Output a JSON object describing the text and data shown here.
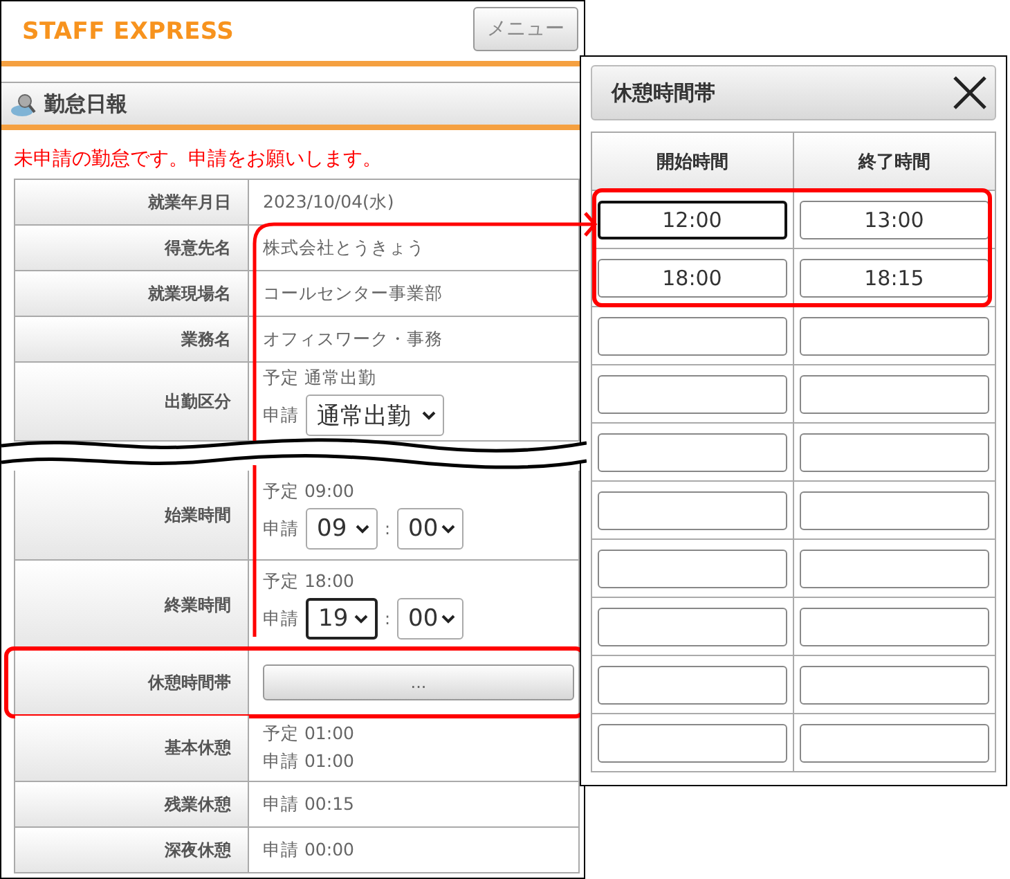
{
  "header": {
    "logo": "STAFF EXPRESS",
    "menu_button": "メニュー"
  },
  "section": {
    "title": "勤怠日報"
  },
  "notice": "未申請の勤怠です。申請をお願いします。",
  "form_rows": [
    {
      "kind": "text",
      "label": "就業年月日",
      "value": "2023/10/04(水)"
    },
    {
      "kind": "text",
      "label": "得意先名",
      "value": "株式会社とうきょう"
    },
    {
      "kind": "text",
      "label": "就業現場名",
      "value": "コールセンター事業部"
    },
    {
      "kind": "text",
      "label": "業務名",
      "value": "オフィスワーク・事務"
    },
    {
      "kind": "select",
      "label": "出勤区分",
      "planned": "予定 通常出勤",
      "request_label": "申請",
      "value": "通常出勤"
    },
    {
      "kind": "omission"
    },
    {
      "kind": "time",
      "label": "始業時間",
      "planned": "予定 09:00",
      "request_label": "申請",
      "hour": "09",
      "separator": ":",
      "minute": "00",
      "hour_focused": false
    },
    {
      "kind": "time",
      "label": "終業時間",
      "planned": "予定 18:00",
      "request_label": "申請",
      "hour": "19",
      "separator": ":",
      "minute": "00",
      "hour_focused": true
    },
    {
      "kind": "button",
      "label": "休憩時間帯",
      "button": "...",
      "highlighted": true
    },
    {
      "kind": "lines",
      "label": "基本休憩",
      "lines": [
        "予定 01:00",
        "申請 01:00"
      ]
    },
    {
      "kind": "text",
      "label": "残業休憩",
      "value": "申請 00:15"
    },
    {
      "kind": "text",
      "label": "深夜休憩",
      "value": "申請 00:00"
    }
  ],
  "dialog": {
    "title": "休憩時間帯",
    "columns": [
      "開始時間",
      "終了時間"
    ],
    "rows": [
      {
        "start": "12:00",
        "end": "13:00",
        "start_focused": true,
        "highlighted": true
      },
      {
        "start": "18:00",
        "end": "18:15",
        "start_focused": false,
        "highlighted": true
      },
      {
        "start_focused": false,
        "highlighted": false
      },
      {
        "start_focused": false,
        "highlighted": false
      },
      {
        "start_focused": false,
        "highlighted": false
      },
      {
        "start_focused": false,
        "highlighted": false
      },
      {
        "start_focused": false,
        "highlighted": false
      },
      {
        "start_focused": false,
        "highlighted": false
      },
      {
        "start_focused": false,
        "highlighted": false
      },
      {
        "start_focused": false,
        "highlighted": false
      }
    ]
  }
}
